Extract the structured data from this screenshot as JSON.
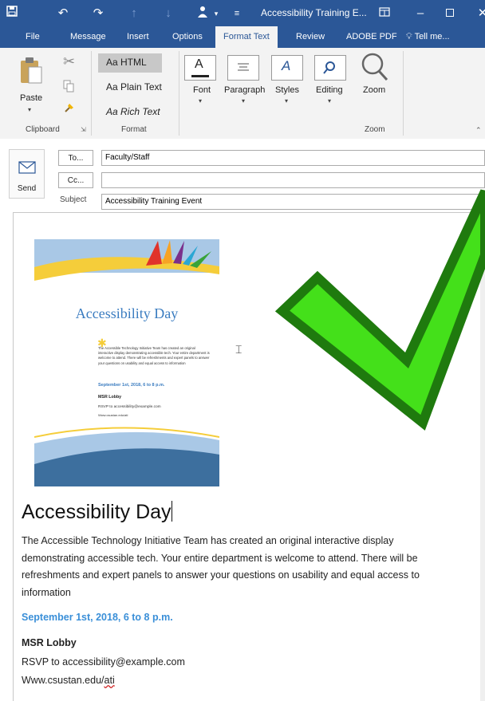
{
  "titlebar": {
    "title": "Accessibility Training E...",
    "bg_color": "#2b5797"
  },
  "tabs": [
    {
      "label": "File"
    },
    {
      "label": "Message"
    },
    {
      "label": "Insert"
    },
    {
      "label": "Options"
    },
    {
      "label": "Format Text"
    },
    {
      "label": "Review"
    },
    {
      "label": "ADOBE PDF"
    },
    {
      "label": "Tell me..."
    }
  ],
  "ribbon": {
    "paste": "Paste",
    "clipboard": "Clipboard",
    "html": "Aa HTML",
    "plain": "Aa Plain Text",
    "rich": "Aa Rich Text",
    "format": "Format",
    "font": "Font",
    "paragraph": "Paragraph",
    "styles": "Styles",
    "editing": "Editing",
    "zoom_btn": "Zoom",
    "zoom_group": "Zoom"
  },
  "compose": {
    "send": "Send",
    "to_button": "To...",
    "cc_button": "Cc...",
    "subject_label": "Subject",
    "to_value": "Faculty/Staff",
    "cc_value": "",
    "subject_value": "Accessibility Training Event"
  },
  "flyer": {
    "title": "Accessibility Day",
    "body": "The Accessible Technology Initiative Team has created an original interactive display demonstrating accessible tech. Your entire department is welcome to attend. There will be refreshments and expert panels to answer your questions on usability and equal access to information",
    "date": "September 1st, 2018, 6 to 8 p.m.",
    "location": "MSR Lobby",
    "rsvp": "RSVP to accessibility@example.com",
    "url": "Www.csustan.edu/ati"
  },
  "email_body": {
    "heading": "Accessibility Day",
    "paragraph": "The Accessible Technology Initiative Team has created an original interactive display demonstrating accessible tech. Your entire department is welcome to attend. There will be refreshments and expert panels to answer your questions on usability and equal access to information",
    "date": "September 1st, 2018, 6 to 8 p.m.",
    "location": "MSR Lobby",
    "rsvp": "RSVP to accessibility@example.com",
    "url_prefix": "Www.csustan.edu/",
    "url_suffix": "ati"
  },
  "colors": {
    "accent": "#2b5797",
    "link_blue": "#3a8fd8",
    "check_green": "#44e01a",
    "check_outline": "#1f7a0e"
  }
}
